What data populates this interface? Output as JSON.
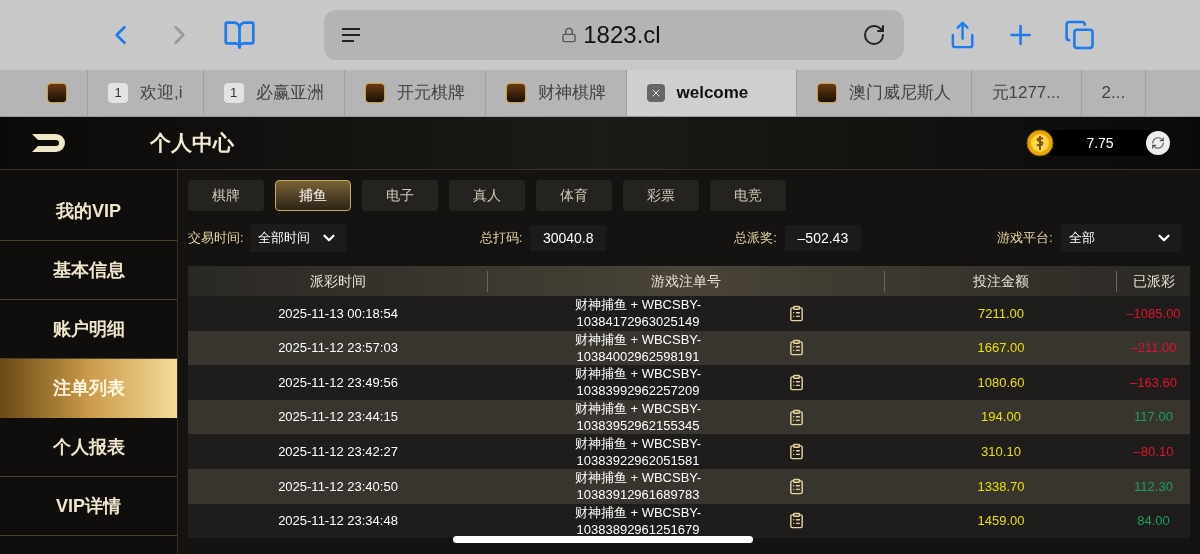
{
  "browser": {
    "address": "1823.cl",
    "tabs": [
      {
        "selected": false,
        "kind": "favicon"
      },
      {
        "label": "欢迎,i",
        "badge": "1",
        "selected": false,
        "kind": "badge"
      },
      {
        "label": "必赢亚洲",
        "badge": "1",
        "selected": false,
        "kind": "badge"
      },
      {
        "label": "开元棋牌",
        "selected": false,
        "kind": "favicon"
      },
      {
        "label": "财神棋牌",
        "selected": false,
        "kind": "favicon"
      },
      {
        "label": "welcome",
        "selected": true,
        "kind": "closable"
      },
      {
        "label": "澳门威尼斯人",
        "selected": false,
        "kind": "favicon"
      },
      {
        "label": "元1277...",
        "selected": false,
        "kind": "plain"
      },
      {
        "label": "2...",
        "selected": false,
        "kind": "plain"
      }
    ]
  },
  "header": {
    "title": "个人中心",
    "balance": "7.75"
  },
  "sidebar": {
    "items": [
      {
        "label": "我的VIP",
        "selected": false
      },
      {
        "label": "基本信息",
        "selected": false
      },
      {
        "label": "账户明细",
        "selected": false
      },
      {
        "label": "注单列表",
        "selected": true
      },
      {
        "label": "个人报表",
        "selected": false
      },
      {
        "label": "VIP详情",
        "selected": false
      }
    ]
  },
  "game_tabs": [
    {
      "label": "棋牌",
      "selected": false
    },
    {
      "label": "捕鱼",
      "selected": true
    },
    {
      "label": "电子",
      "selected": false
    },
    {
      "label": "真人",
      "selected": false
    },
    {
      "label": "体育",
      "selected": false
    },
    {
      "label": "彩票",
      "selected": false
    },
    {
      "label": "电竞",
      "selected": false
    }
  ],
  "filters": {
    "time_label": "交易时间:",
    "time_value": "全部时间",
    "bet_label": "总打码:",
    "bet_value": "30040.8",
    "payout_label": "总派奖:",
    "payout_value": "–502.43",
    "platform_label": "游戏平台:",
    "platform_value": "全部"
  },
  "table": {
    "columns": [
      "派彩时间",
      "游戏注单号",
      "投注金额",
      "已派彩"
    ],
    "rows": [
      {
        "time": "2025-11-13 00:18:54",
        "order": "财神捕鱼 + WBCSBY-",
        "order_no": "10384172963025149",
        "bet": "7211.00",
        "payout": "–1085.00",
        "color": "#e0122c"
      },
      {
        "time": "2025-11-12 23:57:03",
        "order": "财神捕鱼 + WBCSBY-",
        "order_no": "10384002962598191",
        "bet": "1667.00",
        "payout": "–211.00",
        "color": "#e0122c"
      },
      {
        "time": "2025-11-12 23:49:56",
        "order": "财神捕鱼 + WBCSBY-",
        "order_no": "10383992962257209",
        "bet": "1080.60",
        "payout": "–163.60",
        "color": "#e0122c"
      },
      {
        "time": "2025-11-12 23:44:15",
        "order": "财神捕鱼 + WBCSBY-",
        "order_no": "10383952962155345",
        "bet": "194.00",
        "payout": "117.00",
        "color": "#1f9c5a"
      },
      {
        "time": "2025-11-12 23:42:27",
        "order": "财神捕鱼 + WBCSBY-",
        "order_no": "10383922962051581",
        "bet": "310.10",
        "payout": "–80.10",
        "color": "#e0122c"
      },
      {
        "time": "2025-11-12 23:40:50",
        "order": "财神捕鱼 + WBCSBY-",
        "order_no": "10383912961689783",
        "bet": "1338.70",
        "payout": "112.30",
        "color": "#1f9c5a"
      },
      {
        "time": "2025-11-12 23:34:48",
        "order": "财神捕鱼 + WBCSBY-",
        "order_no": "10383892961251679",
        "bet": "1459.00",
        "payout": "84.00",
        "color": "#1f9c5a"
      }
    ]
  }
}
